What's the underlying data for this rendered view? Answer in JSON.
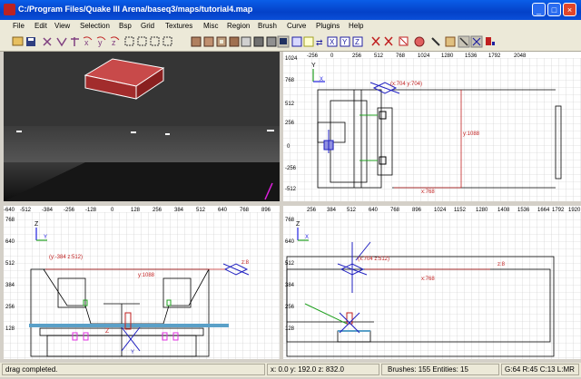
{
  "window": {
    "title": "C:/Program Files/Quake III Arena/baseq3/maps/tutorial4.map",
    "buttons": [
      "_",
      "□",
      "×"
    ]
  },
  "menu": [
    "File",
    "Edit",
    "View",
    "Selection",
    "Bsp",
    "Grid",
    "Textures",
    "Misc",
    "Region",
    "Brush",
    "Curve",
    "Plugins",
    "Help"
  ],
  "toolbar_icons": [
    "open-icon",
    "save-icon",
    "flip-x-icon",
    "flip-y-icon",
    "flip-z-icon",
    "rotate-x-icon",
    "rotate-y-icon",
    "rotate-z-icon",
    "select-complete-icon",
    "select-touching-icon",
    "select-partial-icon",
    "select-inside-icon",
    "csg-subtract-icon",
    "csg-merge-icon",
    "hollow-icon",
    "clipper-icon",
    "change-view-icon",
    "texture-view-icon",
    "cube-view-icon",
    "camera-icon",
    "x-axis-icon",
    "y-axis-icon",
    "z-axis-icon",
    "entity-icon",
    "patch-icon",
    "brush-icon",
    "texture-lock-icon",
    "scale-icon",
    "rotate-icon",
    "drag-icon",
    "point-icon"
  ],
  "views": {
    "top_right": {
      "ruler_x": [
        "-256",
        "0",
        "256",
        "512",
        "768",
        "1024",
        "1280",
        "1536",
        "1792",
        "2048"
      ],
      "ruler_y": [
        "1024",
        "768",
        "512",
        "256",
        "0",
        "-256",
        "-512"
      ],
      "axis_label_v": "Y",
      "axis_label_h": "X",
      "point_label": "(x:704  y:704)",
      "dim_v": "y:1088",
      "dim_h": "x:768"
    },
    "bottom_left": {
      "ruler_x": [
        "-640",
        "-512",
        "-384",
        "-256",
        "-128",
        "0",
        "128",
        "256",
        "384",
        "512",
        "640",
        "768",
        "896"
      ],
      "ruler_y": [
        "768",
        "640",
        "512",
        "384",
        "256",
        "128"
      ],
      "axis_label_v": "Z",
      "axis_label_h": "Y",
      "point_label": "(y:-384  z:512)",
      "dim_h": "y:1088",
      "small_label": "z:8",
      "origin_labels": [
        "Z",
        "Y"
      ]
    },
    "bottom_right": {
      "ruler_x": [
        "256",
        "384",
        "512",
        "640",
        "768",
        "896",
        "1024",
        "1152",
        "1280",
        "1408",
        "1536",
        "1664",
        "1792",
        "1920"
      ],
      "ruler_y": [
        "768",
        "640",
        "512",
        "384",
        "256",
        "128"
      ],
      "axis_label_v": "Z",
      "axis_label_h": "X",
      "point_label": "(x:704  z:512)",
      "dim_h": "x:768",
      "small_label": "z:8"
    }
  },
  "status": {
    "message": "drag completed.",
    "coords": "x: 0.0  y: 192.0  z: 832.0",
    "counts": "Brushes: 155  Entities: 15",
    "grid": "G:64 R:45 C:13 L:MR"
  }
}
